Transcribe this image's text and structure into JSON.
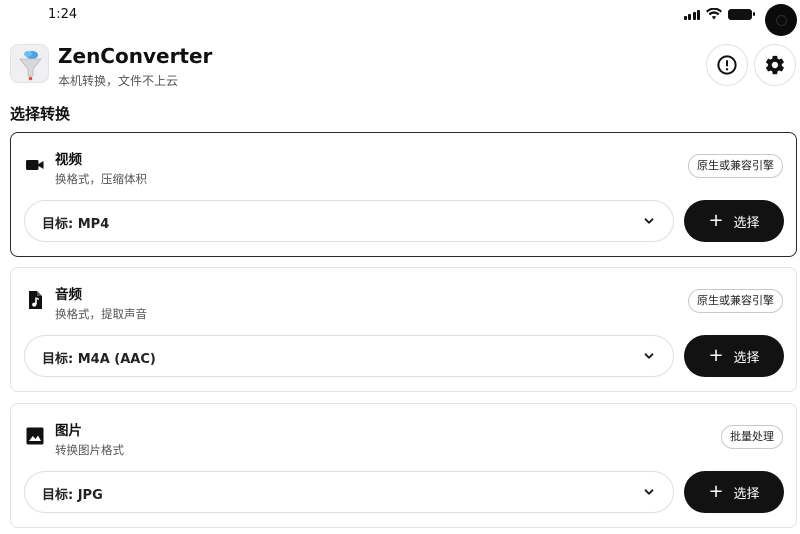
{
  "status_bar": {
    "time": "1:24"
  },
  "header": {
    "app_name": "ZenConverter",
    "tagline": "本机转换，文件不上云",
    "info_icon": "alert-circle-icon",
    "settings_icon": "gear-icon"
  },
  "section_title": "选择转换",
  "cards": [
    {
      "icon": "video-camera-icon",
      "title": "视频",
      "description": "换格式，压缩体积",
      "badge": "原生或兼容引擎",
      "target": "目标: MP4",
      "button": "选择",
      "selected": true
    },
    {
      "icon": "audio-file-icon",
      "title": "音频",
      "description": "换格式，提取声音",
      "badge": "原生或兼容引擎",
      "target": "目标: M4A (AAC)",
      "button": "选择",
      "selected": false
    },
    {
      "icon": "image-icon",
      "title": "图片",
      "description": "转换图片格式",
      "badge": "批量处理",
      "target": "目标: JPG",
      "button": "选择",
      "selected": false
    }
  ],
  "colors": {
    "primary_button": "#121212",
    "selected_border": "#2a2a2a",
    "card_border": "#e3e3e3"
  }
}
